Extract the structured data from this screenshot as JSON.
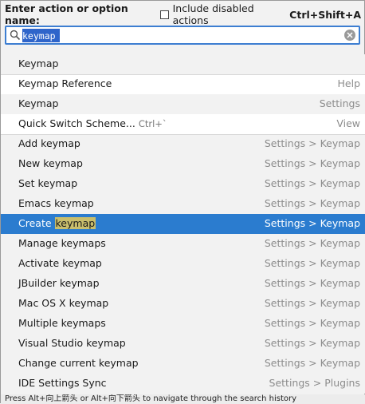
{
  "header": {
    "label": "Enter action or option name:",
    "checkbox_label": "Include disabled actions",
    "shortcut": "Ctrl+Shift+A"
  },
  "search": {
    "value": "keymap"
  },
  "items": [
    {
      "pre": "Keymap",
      "hl": "",
      "post": "",
      "shortcut": "",
      "location": ""
    },
    {
      "pre": "Keymap Reference",
      "hl": "",
      "post": "",
      "shortcut": "",
      "location": "Help"
    },
    {
      "pre": "Keymap",
      "hl": "",
      "post": "",
      "shortcut": "",
      "location": "Settings"
    },
    {
      "pre": "Quick Switch Scheme...",
      "hl": "",
      "post": "",
      "shortcut": "Ctrl+`",
      "location": "View"
    },
    {
      "pre": "Add keymap",
      "hl": "",
      "post": "",
      "shortcut": "",
      "location": "Settings > Keymap"
    },
    {
      "pre": "New keymap",
      "hl": "",
      "post": "",
      "shortcut": "",
      "location": "Settings > Keymap"
    },
    {
      "pre": "Set keymap",
      "hl": "",
      "post": "",
      "shortcut": "",
      "location": "Settings > Keymap"
    },
    {
      "pre": "Emacs keymap",
      "hl": "",
      "post": "",
      "shortcut": "",
      "location": "Settings > Keymap"
    },
    {
      "pre": "Create ",
      "hl": "keymap",
      "post": "",
      "shortcut": "",
      "location": "Settings > Keymap"
    },
    {
      "pre": "Manage keymaps",
      "hl": "",
      "post": "",
      "shortcut": "",
      "location": "Settings > Keymap"
    },
    {
      "pre": "Activate keymap",
      "hl": "",
      "post": "",
      "shortcut": "",
      "location": "Settings > Keymap"
    },
    {
      "pre": "JBuilder keymap",
      "hl": "",
      "post": "",
      "shortcut": "",
      "location": "Settings > Keymap"
    },
    {
      "pre": "Mac OS X keymap",
      "hl": "",
      "post": "",
      "shortcut": "",
      "location": "Settings > Keymap"
    },
    {
      "pre": "Multiple keymaps",
      "hl": "",
      "post": "",
      "shortcut": "",
      "location": "Settings > Keymap"
    },
    {
      "pre": "Visual Studio keymap",
      "hl": "",
      "post": "",
      "shortcut": "",
      "location": "Settings > Keymap"
    },
    {
      "pre": "Change current keymap",
      "hl": "",
      "post": "",
      "shortcut": "",
      "location": "Settings > Keymap"
    },
    {
      "pre": "IDE Settings Sync",
      "hl": "",
      "post": "",
      "shortcut": "",
      "location": "Settings > Plugins"
    }
  ],
  "status": "Press Alt+向上箭头 or Alt+向下箭头 to navigate through the search history",
  "colors": {
    "selection": "#2b7ccf",
    "match_highlight": "#c9be6c",
    "search_border": "#3d7ed1"
  }
}
